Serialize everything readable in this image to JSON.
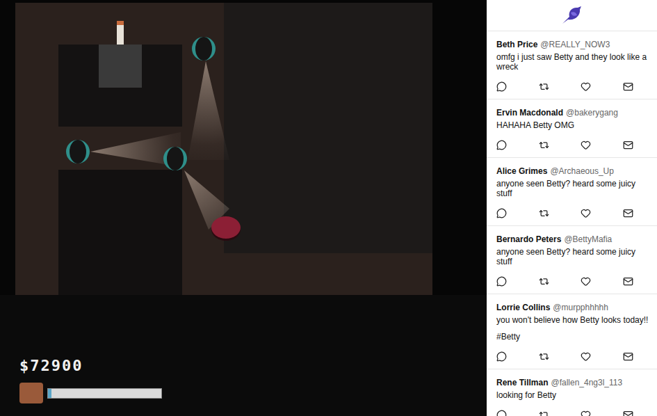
{
  "game": {
    "characters": [
      {
        "kind": "guard"
      },
      {
        "kind": "guard"
      },
      {
        "kind": "guard"
      },
      {
        "kind": "player"
      }
    ],
    "hud": {
      "money": "$72900",
      "meter": {
        "level": 0.03
      }
    }
  },
  "feed": {
    "tweets": [
      {
        "name": "Beth Price",
        "handle": "@REALLY_NOW3",
        "lines": [
          "omfg i just saw Betty and they look like a wreck"
        ]
      },
      {
        "name": "Ervin Macdonald",
        "handle": "@bakerygang",
        "lines": [
          "HAHAHA Betty OMG"
        ]
      },
      {
        "name": "Alice Grimes",
        "handle": "@Archaeous_Up",
        "lines": [
          "anyone seen Betty? heard some juicy stuff"
        ]
      },
      {
        "name": "Bernardo Peters",
        "handle": "@BettyMafia",
        "lines": [
          "anyone seen Betty? heard some juicy stuff"
        ]
      },
      {
        "name": "Lorrie Collins",
        "handle": "@murpphhhhh",
        "lines": [
          "you won't believe how Betty looks today!!",
          "#Betty"
        ]
      },
      {
        "name": "Rene Tillman",
        "handle": "@fallen_4ng3l_113",
        "lines": [
          "looking for Betty"
        ]
      }
    ]
  }
}
